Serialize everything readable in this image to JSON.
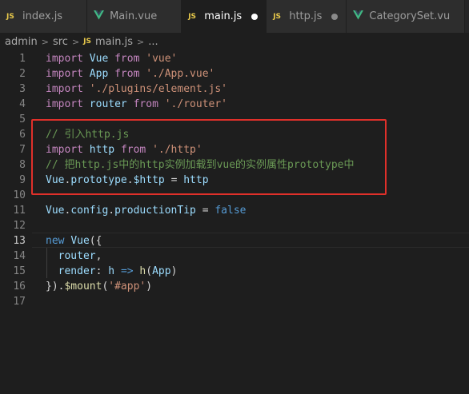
{
  "tabs": [
    {
      "icon": "js-file-icon",
      "label": "index.js",
      "state": "normal"
    },
    {
      "icon": "vue-file-icon",
      "label": "Main.vue",
      "state": "normal"
    },
    {
      "icon": "js-file-icon",
      "label": "main.js",
      "state": "active-modified"
    },
    {
      "icon": "js-file-icon",
      "label": "http.js",
      "state": "modified"
    },
    {
      "icon": "vue-file-icon",
      "label": "CategorySet.vu",
      "state": "normal"
    }
  ],
  "breadcrumb": {
    "items": [
      "admin",
      "src",
      "main.js",
      "..."
    ]
  },
  "editor": {
    "current_line": 13,
    "lines": [
      {
        "n": "1",
        "code": "import Vue from 'vue'"
      },
      {
        "n": "2",
        "code": "import App from './App.vue'"
      },
      {
        "n": "3",
        "code": "import './plugins/element.js'"
      },
      {
        "n": "4",
        "code": "import router from './router'"
      },
      {
        "n": "5",
        "code": ""
      },
      {
        "n": "6",
        "code": "// 引入http.js"
      },
      {
        "n": "7",
        "code": "import http from './http'"
      },
      {
        "n": "8",
        "code": "// 把http.js中的http实例加载到vue的实例属性prototype中"
      },
      {
        "n": "9",
        "code": "Vue.prototype.$http = http"
      },
      {
        "n": "10",
        "code": ""
      },
      {
        "n": "11",
        "code": "Vue.config.productionTip = false"
      },
      {
        "n": "12",
        "code": ""
      },
      {
        "n": "13",
        "code": "new Vue({"
      },
      {
        "n": "14",
        "code": "  router,"
      },
      {
        "n": "15",
        "code": "  render: h => h(App)"
      },
      {
        "n": "16",
        "code": "}).$mount('#app')"
      },
      {
        "n": "17",
        "code": ""
      }
    ]
  },
  "colors": {
    "highlight_box": "#e0302a",
    "keyword": "#569cd6",
    "string": "#ce9178",
    "comment": "#6a9955"
  }
}
